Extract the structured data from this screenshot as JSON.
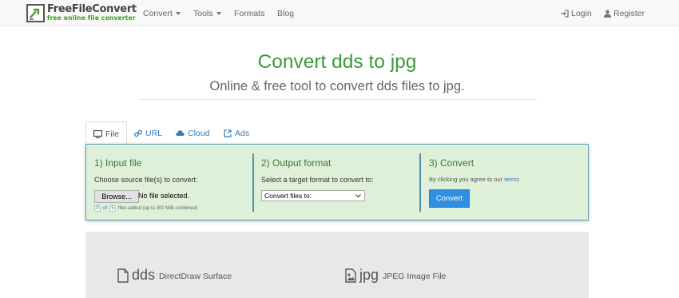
{
  "brand": {
    "title": "FreeFileConvert",
    "tagline": "free online file converter"
  },
  "nav": {
    "items": [
      {
        "label": "Convert",
        "dropdown": true
      },
      {
        "label": "Tools",
        "dropdown": true
      },
      {
        "label": "Formats",
        "dropdown": false
      },
      {
        "label": "Blog",
        "dropdown": false
      }
    ],
    "login": "Login",
    "register": "Register"
  },
  "hero": {
    "title": "Convert dds to jpg",
    "subtitle": "Online & free tool to convert dds files to jpg."
  },
  "tabs": [
    {
      "label": "File",
      "icon": "monitor-icon",
      "active": true
    },
    {
      "label": "URL",
      "icon": "link-icon",
      "active": false
    },
    {
      "label": "Cloud",
      "icon": "cloud-icon",
      "active": false
    },
    {
      "label": "Ads",
      "icon": "external-link-icon",
      "active": false
    }
  ],
  "converter": {
    "input": {
      "heading": "1) Input file",
      "prompt": "Choose source file(s) to convert:",
      "browse_label": "Browse...",
      "file_status": "No file selected.",
      "count_current": "0",
      "count_of": "of",
      "count_max": "5",
      "count_suffix": "files added (up to 300 MiB combined)"
    },
    "output": {
      "heading": "2) Output format",
      "prompt": "Select a target format to convert to:",
      "select_value": "Convert files to:"
    },
    "convert": {
      "heading": "3) Convert",
      "terms_prefix": "By clicking you agree to our",
      "terms_link": "terms",
      "button_label": "Convert"
    }
  },
  "formats": {
    "source": {
      "ext": "dds",
      "name": "DirectDraw Surface",
      "icon": "file-icon"
    },
    "target": {
      "ext": "jpg",
      "name": "JPEG Image File",
      "icon": "image-file-icon"
    }
  },
  "colors": {
    "brand_green": "#3c9a3c",
    "link_blue": "#337ab7",
    "panel_bg": "#dff0d8",
    "panel_border": "#4a90b8",
    "button_blue": "#2f8fe2"
  }
}
